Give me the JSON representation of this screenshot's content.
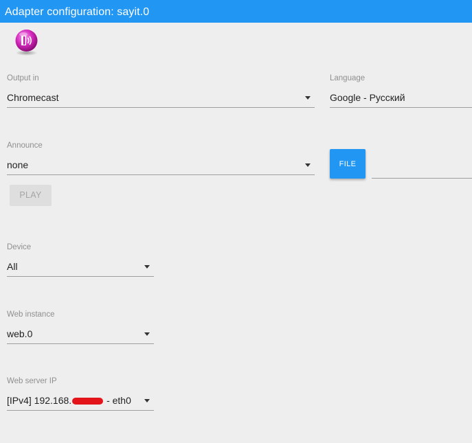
{
  "window": {
    "title": "Adapter configuration: sayit.0"
  },
  "logo": {
    "icon": "sayit-logo-icon",
    "colors": [
      "#e040c8",
      "#a0108a"
    ]
  },
  "output": {
    "label": "Output in",
    "value": "Chromecast"
  },
  "language": {
    "label": "Language",
    "value": "Google - Русский"
  },
  "announce": {
    "label": "Announce",
    "value": "none"
  },
  "file_button": {
    "label": "FILE"
  },
  "play_button": {
    "label": "PLAY"
  },
  "device": {
    "label": "Device",
    "value": "All"
  },
  "web_instance": {
    "label": "Web instance",
    "value": "web.0"
  },
  "web_server_ip": {
    "label": "Web server IP",
    "value_prefix": "[IPv4] 192.168.",
    "value_suffix": " - eth0"
  },
  "colors": {
    "accent": "#2196f3",
    "background": "#eeeeee",
    "redaction": "#e4141b"
  }
}
